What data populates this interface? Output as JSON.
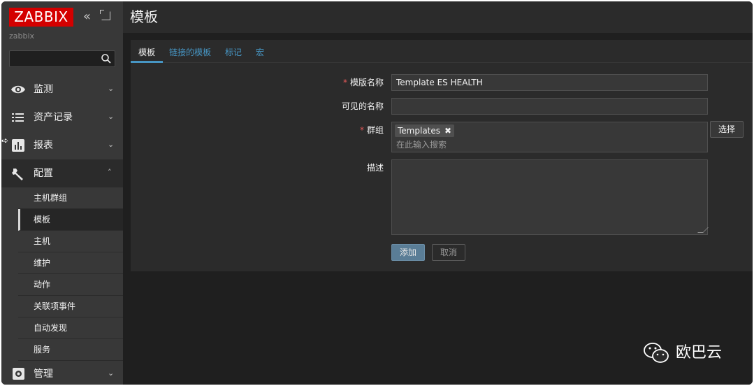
{
  "sidebar": {
    "logo": "ZABBIX",
    "server_name": "zabbix",
    "search_value": "",
    "menu": [
      {
        "label": "监测",
        "icon": "eye-icon"
      },
      {
        "label": "资产记录",
        "icon": "list-icon"
      },
      {
        "label": "报表",
        "icon": "bar-chart-icon"
      },
      {
        "label": "配置",
        "icon": "wrench-icon"
      },
      {
        "label": "管理",
        "icon": "gear-icon"
      }
    ],
    "submenu": [
      "主机群组",
      "模板",
      "主机",
      "维护",
      "动作",
      "关联项事件",
      "自动发现",
      "服务"
    ],
    "active_submenu": "模板"
  },
  "header": {
    "title": "模板"
  },
  "tabs": [
    "模板",
    "链接的模板",
    "标记",
    "宏"
  ],
  "form": {
    "name_label": "模版名称",
    "name_value": "Template ES HEALTH",
    "visible_name_label": "可见的名称",
    "visible_name_value": "",
    "groups_label": "群组",
    "group_tag": "Templates",
    "groups_placeholder": "在此输入搜索",
    "select_label": "选择",
    "description_label": "描述",
    "description_value": "",
    "add_label": "添加",
    "cancel_label": "取消"
  },
  "watermark": {
    "text": "欧巴云"
  },
  "colors": {
    "logo_red": "#d40000",
    "link_blue": "#4796c4",
    "required_red": "#e45959",
    "primary_button": "#5a7d96"
  }
}
